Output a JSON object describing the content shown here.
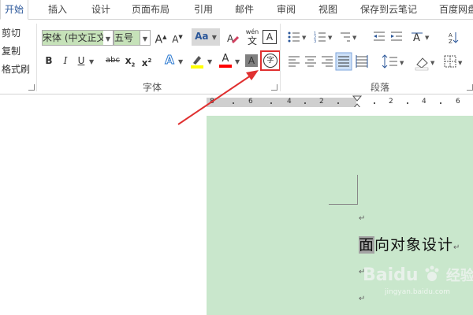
{
  "tabs": [
    "开始",
    "插入",
    "设计",
    "页面布局",
    "引用",
    "邮件",
    "审阅",
    "视图",
    "保存到云笔记",
    "百度网盘"
  ],
  "clipboard": {
    "cut": "剪切",
    "copy": "复制",
    "format_painter": "格式刷"
  },
  "font": {
    "name": "宋体 (中文正文",
    "size": "五号",
    "grow": "A",
    "shrink": "A",
    "case_label": "Aa",
    "phonetic_top": "wén",
    "phonetic_bottom": "文",
    "border_char": "A",
    "bold": "B",
    "italic": "I",
    "underline": "U",
    "strike": "abc",
    "sub": "x",
    "sub_mark": "2",
    "sup": "x",
    "sup_mark": "2",
    "effects": "A",
    "font_color": "A",
    "shade_char": "A",
    "enclose_char": "字",
    "group_label": "字体"
  },
  "paragraph": {
    "group_label": "段落"
  },
  "ruler": {
    "numbers": [
      "8",
      "6",
      "4",
      "2",
      "2",
      "4",
      "6"
    ]
  },
  "document": {
    "text_selected": "面",
    "text_rest": "向对象设计",
    "para_mark": "↵"
  },
  "watermark": {
    "brand": "Baidu",
    "cn": "经验",
    "url": "jingyan.baidu.com"
  },
  "colors": {
    "accent": "#2b579a",
    "page_bg": "#c9e7cc",
    "highlight": "#ffff00",
    "font_red": "#ff0000",
    "callout_red": "#e03030"
  }
}
